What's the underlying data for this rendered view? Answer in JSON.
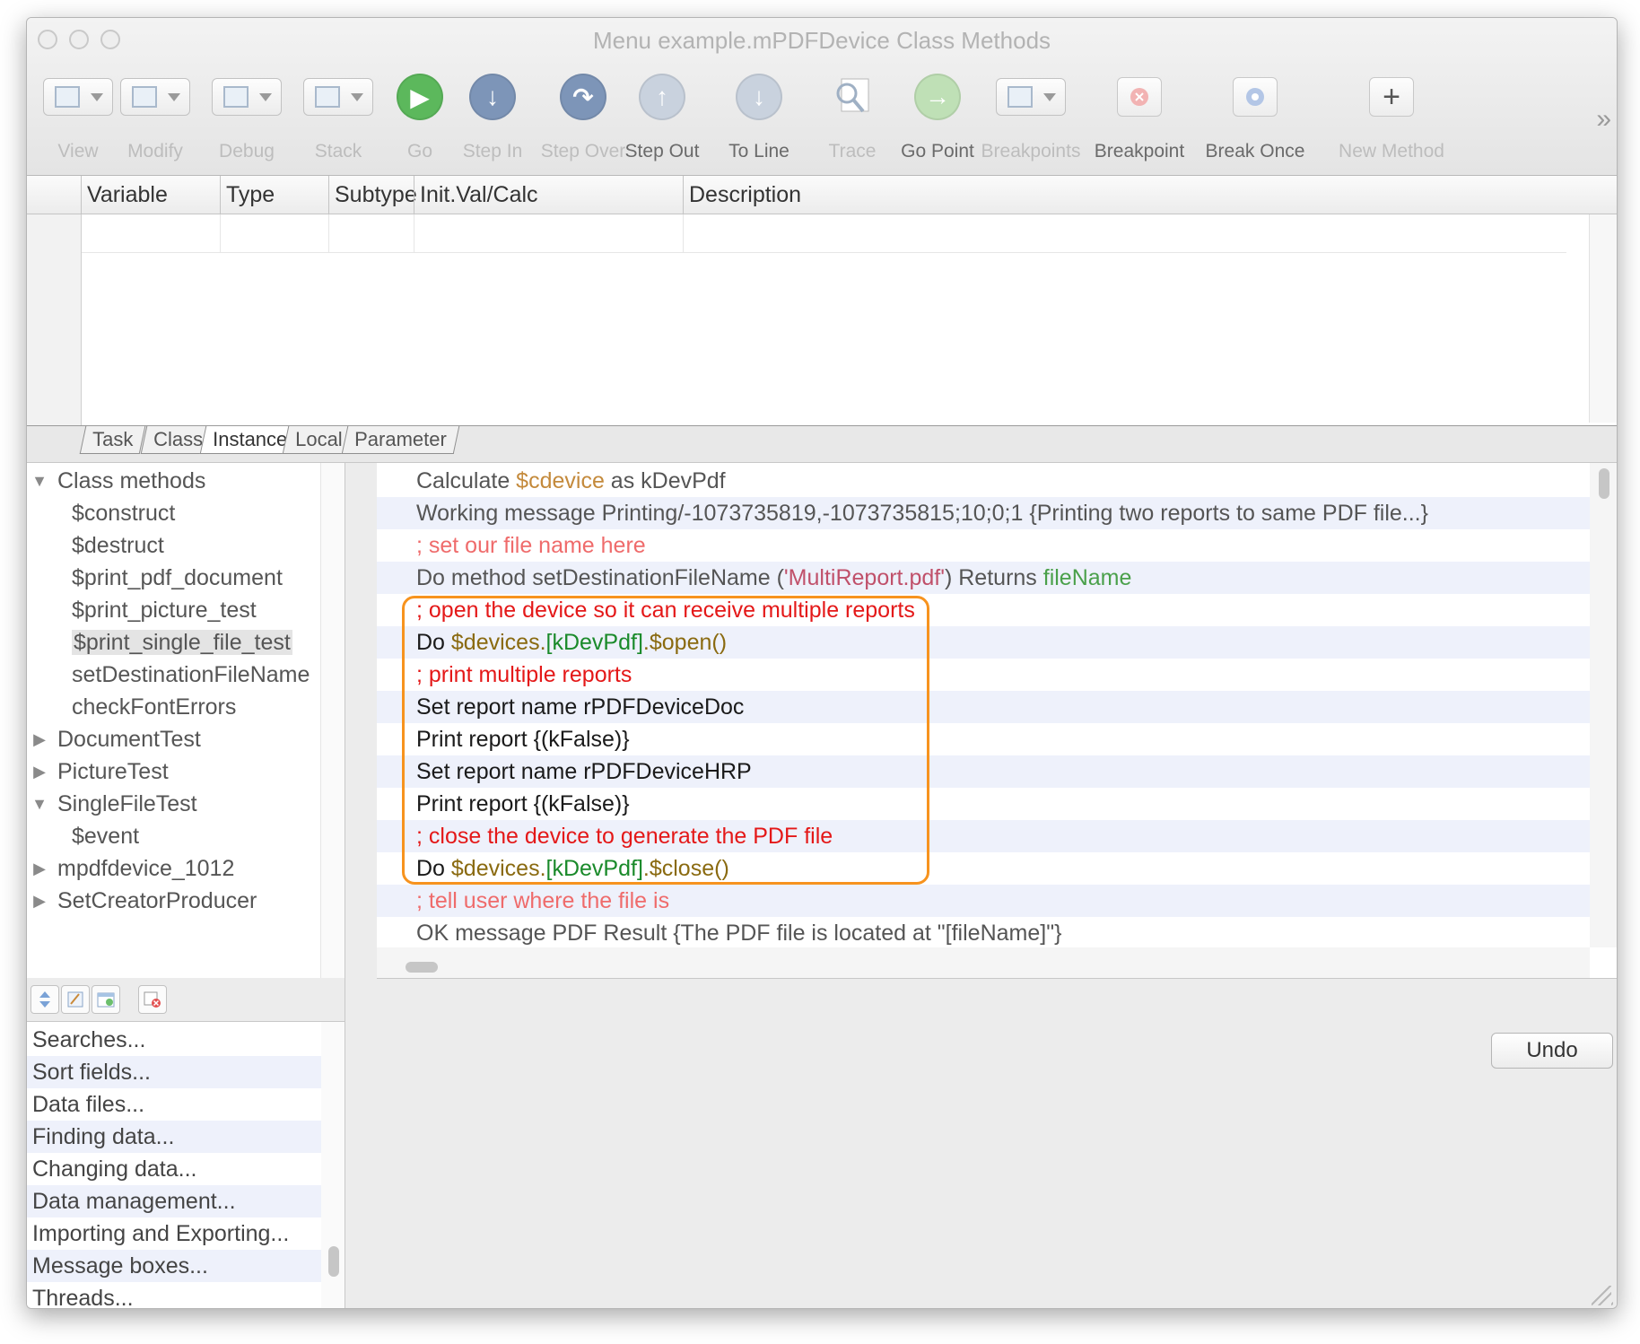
{
  "window": {
    "title": "Menu example.mPDFDevice Class Methods"
  },
  "toolbar": {
    "items": [
      {
        "label": "View",
        "icon": "view-icon",
        "enabled": false
      },
      {
        "label": "Modify",
        "icon": "modify-icon",
        "enabled": false
      },
      {
        "label": "Debug",
        "icon": "debug-icon",
        "enabled": false
      },
      {
        "label": "Stack",
        "icon": "stack-icon",
        "enabled": false
      },
      {
        "label": "Go",
        "icon": "play-icon",
        "enabled": false
      },
      {
        "label": "Step In",
        "icon": "step-in-icon",
        "enabled": false
      },
      {
        "label": "Step Over",
        "icon": "step-over-icon",
        "enabled": false
      },
      {
        "label": "Step Out",
        "icon": "step-out-icon",
        "enabled": true
      },
      {
        "label": "To Line",
        "icon": "to-line-icon",
        "enabled": true
      },
      {
        "label": "Trace",
        "icon": "trace-icon",
        "enabled": false
      },
      {
        "label": "Go Point",
        "icon": "go-point-icon",
        "enabled": true
      },
      {
        "label": "Breakpoints",
        "icon": "breakpoints-icon",
        "enabled": false
      },
      {
        "label": "Breakpoint",
        "icon": "breakpoint-icon",
        "enabled": true
      },
      {
        "label": "Break Once",
        "icon": "break-once-icon",
        "enabled": true
      },
      {
        "label": "New Method",
        "icon": "plus-icon",
        "enabled": false
      }
    ],
    "overflow": "»"
  },
  "variables": {
    "columns": [
      "Variable",
      "Type",
      "Subtype",
      "Init.Val/Calc",
      "Description"
    ]
  },
  "scope_tabs": [
    "Task",
    "Class",
    "Instance",
    "Local",
    "Parameter"
  ],
  "active_scope_tab": "Instance",
  "tree": {
    "items": [
      {
        "label": "Class methods",
        "expander": "▼"
      },
      {
        "label": "$construct",
        "expander": ""
      },
      {
        "label": "$destruct",
        "expander": ""
      },
      {
        "label": "$print_pdf_document",
        "expander": ""
      },
      {
        "label": "$print_picture_test",
        "expander": ""
      },
      {
        "label": "$print_single_file_test",
        "expander": ""
      },
      {
        "label": "setDestinationFileName",
        "expander": ""
      },
      {
        "label": "checkFontErrors",
        "expander": ""
      },
      {
        "label": "DocumentTest",
        "expander": "▶"
      },
      {
        "label": "PictureTest",
        "expander": "▶"
      },
      {
        "label": "SingleFileTest",
        "expander": "▼"
      },
      {
        "label": "$event",
        "expander": ""
      },
      {
        "label": "mpdfdevice_1012",
        "expander": "▶"
      },
      {
        "label": "SetCreatorProducer",
        "expander": "▶"
      }
    ],
    "selected": "$print_single_file_test"
  },
  "code": {
    "lines": [
      [
        {
          "t": "Calculate ",
          "c": "kw"
        },
        {
          "t": "$cdevice",
          "c": "var"
        },
        {
          "t": " as kDevPdf",
          "c": "kw"
        }
      ],
      [
        {
          "t": "Working message Printing/-1073735819,-1073735815;10;0;1 {Printing two reports to same PDF file...}",
          "c": "kw"
        }
      ],
      [
        {
          "t": ";  set our file name here",
          "c": "comment"
        }
      ],
      [
        {
          "t": "Do method setDestinationFileName (",
          "c": "kw"
        },
        {
          "t": "'MultiReport.pdf'",
          "c": "str"
        },
        {
          "t": ") Returns ",
          "c": "kw"
        },
        {
          "t": "fileName",
          "c": "field"
        }
      ],
      [
        {
          "t": ";  open the device so it can receive multiple reports",
          "c": "comment"
        }
      ],
      [
        {
          "t": "Do ",
          "c": "kw"
        },
        {
          "t": "$devices.",
          "c": "var"
        },
        {
          "t": "[kDevPdf]",
          "c": "field"
        },
        {
          "t": ".$open()",
          "c": "var"
        }
      ],
      [
        {
          "t": ";  print multiple reports",
          "c": "comment"
        }
      ],
      [
        {
          "t": "Set report name rPDFDeviceDoc",
          "c": "kw"
        }
      ],
      [
        {
          "t": "Print report {(kFalse)}",
          "c": "kw"
        }
      ],
      [
        {
          "t": "Set report name rPDFDeviceHRP",
          "c": "kw"
        }
      ],
      [
        {
          "t": "Print report {(kFalse)}",
          "c": "kw"
        }
      ],
      [
        {
          "t": ";  close the device to generate the PDF file",
          "c": "comment"
        }
      ],
      [
        {
          "t": "Do ",
          "c": "kw"
        },
        {
          "t": "$devices.",
          "c": "var"
        },
        {
          "t": "[kDevPdf]",
          "c": "field"
        },
        {
          "t": ".$close()",
          "c": "var"
        }
      ],
      [
        {
          "t": ";  tell user where the file is",
          "c": "comment"
        }
      ],
      [
        {
          "t": "OK message PDF Result {The PDF file is located at \"[fileName]\"}",
          "c": "kw"
        }
      ]
    ],
    "highlighted_range": [
      4,
      12
    ]
  },
  "help_topics": [
    "Searches...",
    "Sort fields...",
    "Data files...",
    "Finding data...",
    "Changing data...",
    "Data management...",
    "Importing and Exporting...",
    "Message boxes...",
    "Threads..."
  ],
  "undo_label": "Undo",
  "colors": {
    "highlight_box": "#f7931e",
    "go_button": "#5cb85c",
    "step_button": "#7d95b8"
  }
}
